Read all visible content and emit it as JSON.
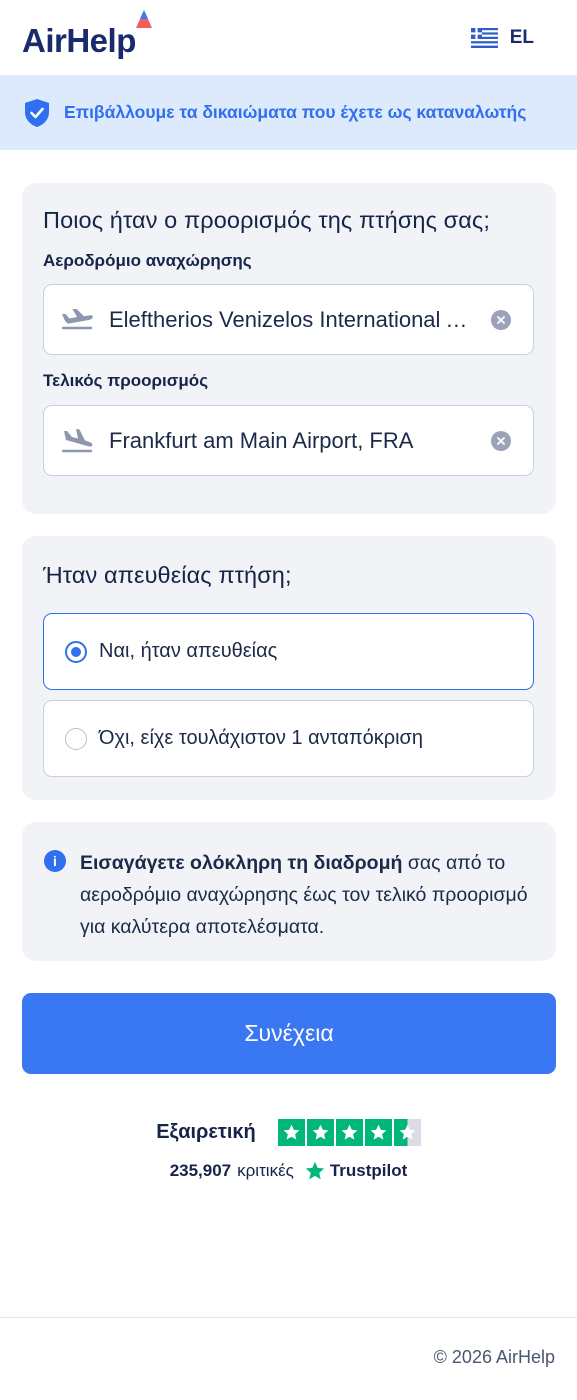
{
  "header": {
    "logo_text": "AirHelp",
    "language_code": "EL",
    "flag_icon": "greece-flag-icon"
  },
  "banner": {
    "icon": "shield-check-icon",
    "text": "Επιβάλλουμε τα δικαιώματα που έχετε ως καταναλωτής"
  },
  "route": {
    "title": "Ποιος ήταν ο προορισμός της πτήσης σας;",
    "departure_label": "Αεροδρόμιο αναχώρησης",
    "departure_value": "Eleftherios Venizelos International Airport, ATH",
    "arrival_label": "Τελικός προορισμός",
    "arrival_value": "Frankfurt am Main Airport, FRA"
  },
  "direct": {
    "title": "Ήταν απευθείας πτήση;",
    "options": [
      {
        "label": "Ναι, ήταν απευθείας",
        "selected": true
      },
      {
        "label": "Όχι, είχε τουλάχιστον 1 ανταπόκριση",
        "selected": false
      }
    ]
  },
  "info": {
    "bold": "Εισαγάγετε ολόκληρη τη διαδρομή",
    "rest": " σας από το αεροδρόμιο αναχώρησης έως τον τελικό προορισμό για καλύτερα αποτελέσματα."
  },
  "cta": {
    "label": "Συνέχεια"
  },
  "trust": {
    "rating_word": "Εξαιρετική",
    "stars": 4.5,
    "review_count": "235,907",
    "review_word": "κριτικές",
    "brand": "Trustpilot"
  },
  "footer": {
    "copyright": "© 2026 AirHelp"
  },
  "colors": {
    "primary": "#3a77f2",
    "banner_bg": "#dceafc",
    "card_bg": "#f1f3f7",
    "trustpilot_green": "#00b67a"
  }
}
